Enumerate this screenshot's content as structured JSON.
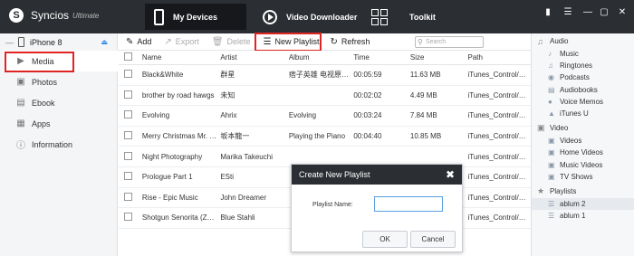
{
  "app": {
    "name": "Syncios",
    "edition": "Ultimate",
    "logo_glyph": "S"
  },
  "nav": {
    "tabs": [
      {
        "label": "My Devices",
        "icon": "phone-icon",
        "active": true
      },
      {
        "label": "Video Downloader",
        "icon": "play-circle-icon",
        "active": false
      },
      {
        "label": "Toolkit",
        "icon": "grid-icon",
        "active": false
      }
    ]
  },
  "window_controls": [
    "chat-icon",
    "menu-icon",
    "minimize-icon",
    "maximize-icon",
    "close-icon"
  ],
  "device": {
    "name": "iPhone 8",
    "eject_icon": "eject-icon"
  },
  "sidebar": {
    "items": [
      {
        "label": "Media",
        "icon": "media-icon",
        "active": true
      },
      {
        "label": "Photos",
        "icon": "photos-icon",
        "active": false
      },
      {
        "label": "Ebook",
        "icon": "ebook-icon",
        "active": false
      },
      {
        "label": "Apps",
        "icon": "apps-icon",
        "active": false
      },
      {
        "label": "Information",
        "icon": "info-icon",
        "active": false
      }
    ]
  },
  "toolbar": {
    "add": "Add",
    "export": "Export",
    "delete": "Delete",
    "new_playlist": "New Playlist",
    "refresh": "Refresh",
    "search_placeholder": "Search"
  },
  "table": {
    "columns": [
      "Name",
      "Artist",
      "Album",
      "Time",
      "Size",
      "Path"
    ],
    "rows": [
      [
        "Black&White",
        "群星",
        "痞子英雄 电视原声...",
        "00:05:59",
        "11.63 MB",
        "iTunes_Control/Mu..."
      ],
      [
        "brother by road hawgs",
        "未知",
        "",
        "00:02:02",
        "4.49 MB",
        "iTunes_Control/Mu..."
      ],
      [
        "Evolving",
        "Ahrix",
        "Evolving",
        "00:03:24",
        "7.84 MB",
        "iTunes_Control/Mu..."
      ],
      [
        "Merry Christmas Mr. La...",
        "坂本龍一",
        "Playing the Piano",
        "00:04:40",
        "10.85 MB",
        "iTunes_Control/Mu..."
      ],
      [
        "Night Photography",
        "Marika Takeuchi",
        "",
        "",
        "",
        "iTunes_Control/Mu..."
      ],
      [
        "Prologue Part 1",
        "ESti",
        "",
        "",
        "",
        "iTunes_Control/Mu..."
      ],
      [
        "Rise - Epic Music",
        "John Dreamer",
        "",
        "",
        "",
        "iTunes_Control/Mu..."
      ],
      [
        "Shotgun Senorita (Zard...",
        "Blue Stahli",
        "",
        "",
        "",
        "iTunes_Control/Mu..."
      ]
    ]
  },
  "right_panel": {
    "audio": {
      "label": "Audio",
      "items": [
        "Music",
        "Ringtones",
        "Podcasts",
        "Audiobooks",
        "Voice Memos",
        "iTunes U"
      ]
    },
    "video": {
      "label": "Video",
      "items": [
        "Videos",
        "Home Videos",
        "Music Videos",
        "TV Shows"
      ]
    },
    "playlists": {
      "label": "Playlists",
      "items": [
        "ablum 2",
        "ablum 1"
      ],
      "active": "ablum 2"
    }
  },
  "dialog": {
    "title": "Create New Playlist",
    "field_label": "Playlist Name:",
    "field_value": "",
    "ok": "OK",
    "cancel": "Cancel"
  },
  "colors": {
    "topbar": "#2b2e33",
    "highlight": "#e02424",
    "accent": "#3a8ee6"
  }
}
